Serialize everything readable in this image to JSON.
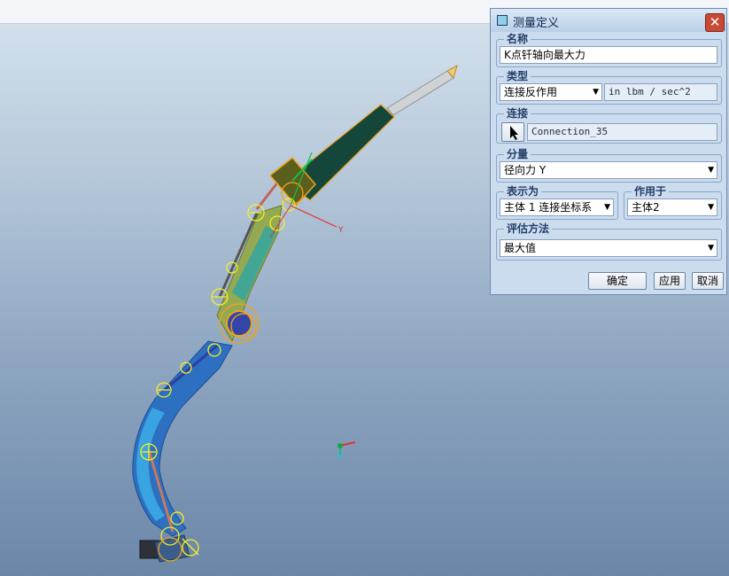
{
  "dialog": {
    "title": "测量定义",
    "name_group": {
      "legend": "名称",
      "value": "K点钎轴向最大力"
    },
    "type_group": {
      "legend": "类型",
      "selected": "连接反作用",
      "units": "in lbm / sec^2"
    },
    "connection_group": {
      "legend": "连接",
      "value": "Connection_35"
    },
    "component_group": {
      "legend": "分量",
      "selected": "径向力 Y"
    },
    "express_group": {
      "legend": "表示为",
      "selected": "主体 1 连接坐标系"
    },
    "apply_to_group": {
      "legend": "作用于",
      "selected": "主体2"
    },
    "eval_group": {
      "legend": "评估方法",
      "selected": "最大值"
    },
    "buttons": {
      "ok": "确定",
      "apply": "应用",
      "cancel": "取消"
    }
  },
  "scene": {
    "triad_label": "Y",
    "colors": {
      "background_top": "#d7e4ef",
      "background_bottom": "#6b87a8",
      "handle_dark_green": "#14463a",
      "arm_blue": "#2d6fc0",
      "light_blue": "#3ca8e6",
      "olive_link": "#93a952",
      "highlight": "#f2a21a",
      "annotation_yellow": "#f5f023",
      "axis_red": "#e33030"
    }
  }
}
